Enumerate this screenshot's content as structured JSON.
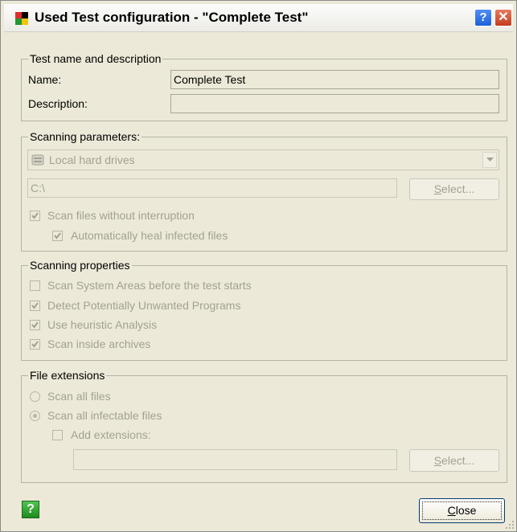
{
  "window": {
    "title": "Used Test configuration - \"Complete Test\"",
    "help_glyph": "?",
    "close_glyph": "✕",
    "icon": "application-logo-icon"
  },
  "test_name_group": {
    "legend": "Test name and description",
    "name_label": "Name:",
    "name_value": "Complete Test",
    "description_label": "Description:",
    "description_value": ""
  },
  "scanning_parameters": {
    "legend": "Scanning parameters:",
    "drive_selected": "Local hard drives",
    "drive_icon": "hard-drive-icon",
    "path_value": "C:\\",
    "select_button_pre": "",
    "select_button_ul": "S",
    "select_button_post": "elect...",
    "scan_without_interruption": {
      "label": "Scan files without interruption",
      "checked": true
    },
    "auto_heal": {
      "label": "Automatically heal infected files",
      "checked": true
    }
  },
  "scanning_properties": {
    "legend": "Scanning properties",
    "items": [
      {
        "label": "Scan System Areas before the test starts",
        "checked": false
      },
      {
        "label": "Detect Potentially Unwanted Programs",
        "checked": true
      },
      {
        "label": "Use heuristic Analysis",
        "checked": true
      },
      {
        "label": "Scan inside archives",
        "checked": true
      }
    ]
  },
  "file_extensions": {
    "legend": "File extensions",
    "scan_all_files": {
      "label": "Scan all files",
      "selected": false
    },
    "scan_all_infectable": {
      "label": "Scan all infectable files",
      "selected": true
    },
    "add_extensions": {
      "label": "Add extensions:",
      "checked": false
    },
    "extensions_value": "",
    "select_button_ul": "S",
    "select_button_post": "elect..."
  },
  "footer": {
    "help_glyph": "?",
    "close_button_ul": "C",
    "close_button_post": "lose"
  },
  "colors": {
    "disabled_text": "#a3a191",
    "dialog_bg": "#ece9d8",
    "help_green": "#1d8a1d",
    "title_close_red": "#c43d1d",
    "title_help_blue": "#1f5fd8"
  }
}
